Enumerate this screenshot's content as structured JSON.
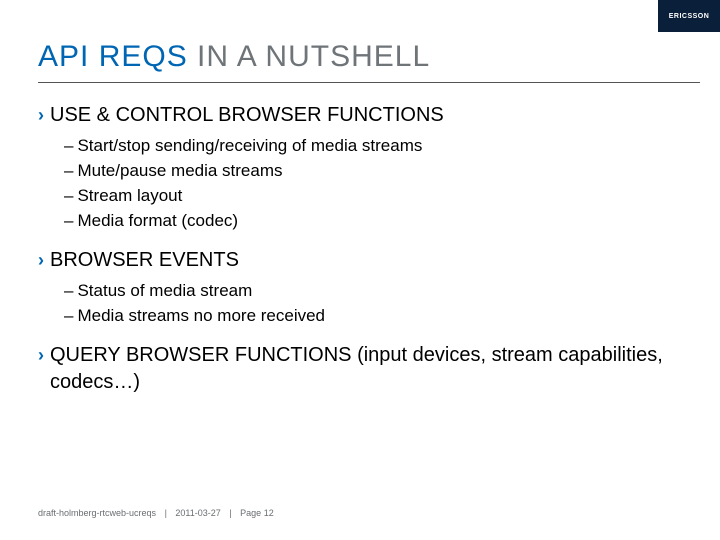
{
  "logo": {
    "text": "ERICSSON"
  },
  "title": {
    "accent": "API REQS",
    "rest": " IN A NUTSHELL"
  },
  "sections": [
    {
      "title": "USE & CONTROL BROWSER FUNCTIONS",
      "items": [
        "Start/stop sending/receiving of media streams",
        "Mute/pause media streams",
        "Stream layout",
        "Media format (codec)"
      ]
    },
    {
      "title": "BROWSER EVENTS",
      "items": [
        "Status of media stream",
        "Media streams no more received"
      ]
    },
    {
      "title": "QUERY BROWSER FUNCTIONS (input devices, stream capabilities, codecs…)",
      "items": []
    }
  ],
  "footer": {
    "doc": "draft-holmberg-rtcweb-ucreqs",
    "date": "2011-03-27",
    "page": "Page 12"
  }
}
